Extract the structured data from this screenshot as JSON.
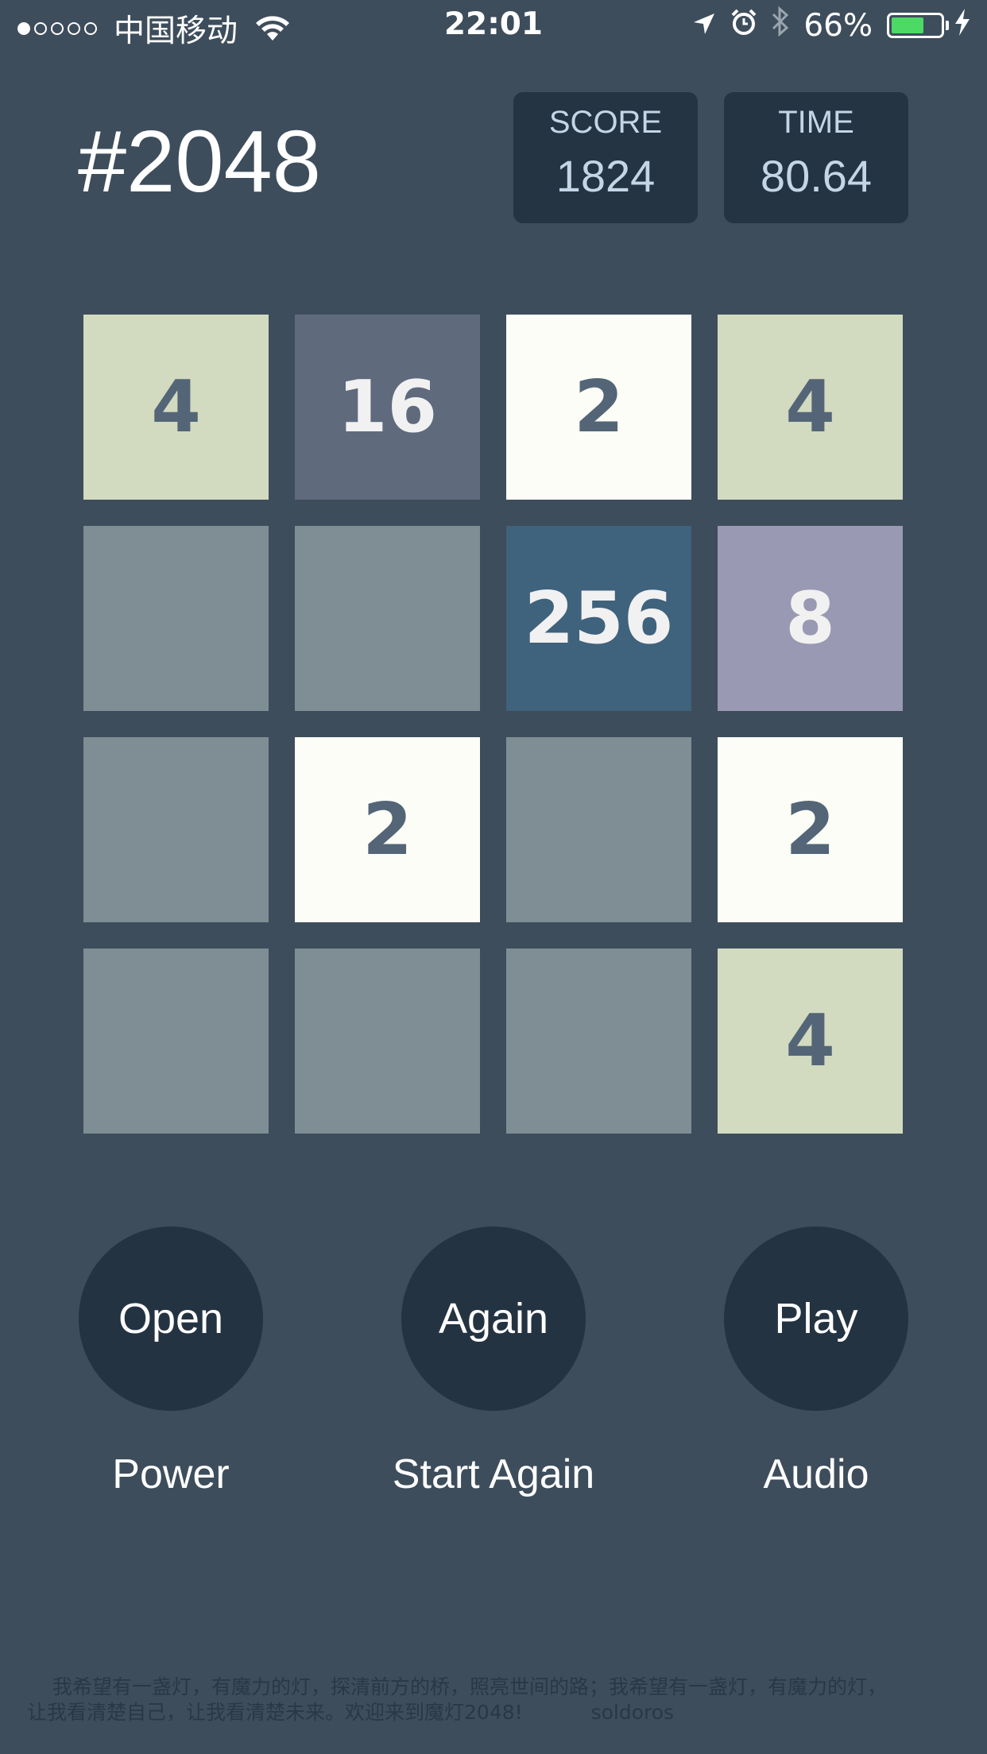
{
  "status_bar": {
    "signal_dots_filled": 1,
    "signal_dots_total": 5,
    "carrier": "中国移动",
    "time": "22:01",
    "battery_percent": "66%",
    "battery_level": 0.66
  },
  "header": {
    "title": "#2048",
    "score_label": "SCORE",
    "score_value": "1824",
    "time_label": "TIME",
    "time_value": "80.64"
  },
  "board": [
    [
      4,
      16,
      2,
      4
    ],
    [
      0,
      0,
      256,
      8
    ],
    [
      0,
      2,
      0,
      2
    ],
    [
      0,
      0,
      0,
      4
    ]
  ],
  "tile_colors": {
    "0": {
      "bg": "#7f8d94",
      "fg": "#7f8d94"
    },
    "2": {
      "bg": "#fcfdf6",
      "fg": "#536577"
    },
    "4": {
      "bg": "#d2dabf",
      "fg": "#536577"
    },
    "8": {
      "bg": "#9a99b3",
      "fg": "#f1f1f1"
    },
    "16": {
      "bg": "#5f6a7d",
      "fg": "#f1f1f1"
    },
    "256": {
      "bg": "#3f627d",
      "fg": "#f1f1f1"
    }
  },
  "controls": {
    "open_label": "Open",
    "power_caption": "Power",
    "again_label": "Again",
    "again_caption": "Start Again",
    "play_label": "Play",
    "audio_caption": "Audio"
  },
  "footer": {
    "line1": "我希望有一盏灯，有魔力的灯，探清前方的桥，照亮世间的路；我希望有一盏灯，有魔力的灯，",
    "line2": "让我看清楚自己，让我看清楚未来。欢迎来到魔灯2048!",
    "author": "soldoros"
  }
}
